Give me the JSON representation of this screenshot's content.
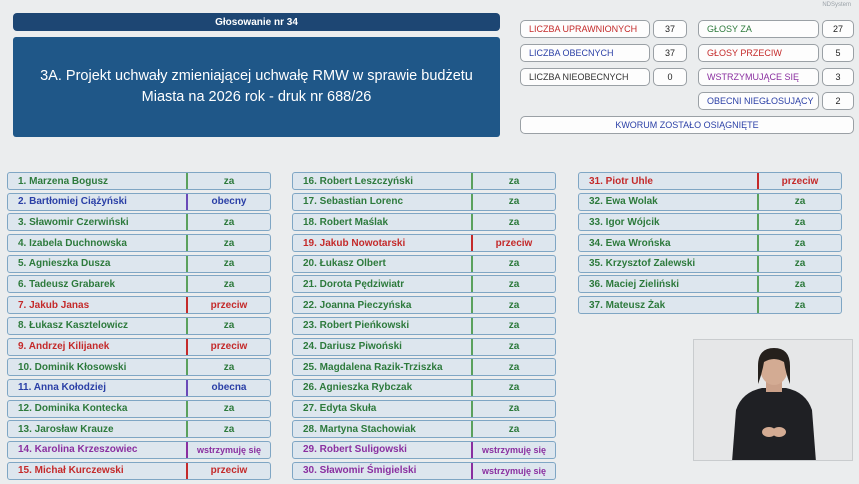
{
  "brand": "NDSystem",
  "vote_title": "Głosowanie nr 34",
  "resolution": "3A. Projekt uchwały zmieniającej uchwałę RMW w sprawie budżetu Miasta na 2026 rok - druk nr 688/26",
  "stats_left": [
    {
      "label": "LICZBA UPRAWNIONYCH",
      "value": "37",
      "color": "#c42a2a"
    },
    {
      "label": "LICZBA OBECNYCH",
      "value": "37",
      "color": "#2a3fa6"
    },
    {
      "label": "LICZBA NIEOBECNYCH",
      "value": "0",
      "color": "#333333"
    }
  ],
  "stats_right": [
    {
      "label": "GŁOSY ZA",
      "value": "27",
      "color": "#2d7a3c"
    },
    {
      "label": "GŁOSY PRZECIW",
      "value": "5",
      "color": "#c42a2a"
    },
    {
      "label": "WSTRZYMUJĄCE SIĘ",
      "value": "3",
      "color": "#8a2fa0"
    },
    {
      "label": "OBECNI NIEGŁOSUJĄCY",
      "value": "2",
      "color": "#2a3fa6"
    }
  ],
  "quorum": "KWORUM ZOSTAŁO OSIĄGNIĘTE",
  "columns": [
    [
      {
        "name": "1. Marzena Bogusz",
        "vote": "za",
        "cls": "za"
      },
      {
        "name": "2. Bartłomiej Ciążyński",
        "vote": "obecny",
        "cls": "obecny"
      },
      {
        "name": "3. Sławomir Czerwiński",
        "vote": "za",
        "cls": "za"
      },
      {
        "name": "4. Izabela Duchnowska",
        "vote": "za",
        "cls": "za"
      },
      {
        "name": "5. Agnieszka Dusza",
        "vote": "za",
        "cls": "za"
      },
      {
        "name": "6. Tadeusz Grabarek",
        "vote": "za",
        "cls": "za"
      },
      {
        "name": "7. Jakub Janas",
        "vote": "przeciw",
        "cls": "przeciw"
      },
      {
        "name": "8. Łukasz Kasztelowicz",
        "vote": "za",
        "cls": "za"
      },
      {
        "name": "9. Andrzej Kilijanek",
        "vote": "przeciw",
        "cls": "przeciw"
      },
      {
        "name": "10. Dominik Kłosowski",
        "vote": "za",
        "cls": "za"
      },
      {
        "name": "11. Anna Kołodziej",
        "vote": "obecna",
        "cls": "obecna"
      },
      {
        "name": "12. Dominika Kontecka",
        "vote": "za",
        "cls": "za"
      },
      {
        "name": "13. Jarosław Krauze",
        "vote": "za",
        "cls": "za"
      },
      {
        "name": "14. Karolina Krzeszowiec",
        "vote": "wstrzymuję się",
        "cls": "wstrzymuje"
      },
      {
        "name": "15. Michał Kurczewski",
        "vote": "przeciw",
        "cls": "przeciw"
      }
    ],
    [
      {
        "name": "16. Robert Leszczyński",
        "vote": "za",
        "cls": "za"
      },
      {
        "name": "17. Sebastian Lorenc",
        "vote": "za",
        "cls": "za"
      },
      {
        "name": "18. Robert Maślak",
        "vote": "za",
        "cls": "za"
      },
      {
        "name": "19. Jakub Nowotarski",
        "vote": "przeciw",
        "cls": "przeciw"
      },
      {
        "name": "20. Łukasz Olbert",
        "vote": "za",
        "cls": "za"
      },
      {
        "name": "21. Dorota Pędziwiatr",
        "vote": "za",
        "cls": "za"
      },
      {
        "name": "22. Joanna Pieczyńska",
        "vote": "za",
        "cls": "za"
      },
      {
        "name": "23. Robert Pieńkowski",
        "vote": "za",
        "cls": "za"
      },
      {
        "name": "24. Dariusz Piwoński",
        "vote": "za",
        "cls": "za"
      },
      {
        "name": "25. Magdalena Razik-Trziszka",
        "vote": "za",
        "cls": "za"
      },
      {
        "name": "26. Agnieszka Rybczak",
        "vote": "za",
        "cls": "za"
      },
      {
        "name": "27. Edyta Skuła",
        "vote": "za",
        "cls": "za"
      },
      {
        "name": "28. Martyna Stachowiak",
        "vote": "za",
        "cls": "za"
      },
      {
        "name": "29. Robert Suligowski",
        "vote": "wstrzymuję się",
        "cls": "wstrzymuje"
      },
      {
        "name": "30. Sławomir Śmigielski",
        "vote": "wstrzymuję się",
        "cls": "wstrzymuje"
      }
    ],
    [
      {
        "name": "31. Piotr Uhle",
        "vote": "przeciw",
        "cls": "przeciw"
      },
      {
        "name": "32. Ewa Wolak",
        "vote": "za",
        "cls": "za"
      },
      {
        "name": "33. Igor Wójcik",
        "vote": "za",
        "cls": "za"
      },
      {
        "name": "34. Ewa Wrońska",
        "vote": "za",
        "cls": "za"
      },
      {
        "name": "35. Krzysztof Zalewski",
        "vote": "za",
        "cls": "za"
      },
      {
        "name": "36. Maciej Zieliński",
        "vote": "za",
        "cls": "za"
      },
      {
        "name": "37. Mateusz Żak",
        "vote": "za",
        "cls": "za"
      }
    ]
  ]
}
